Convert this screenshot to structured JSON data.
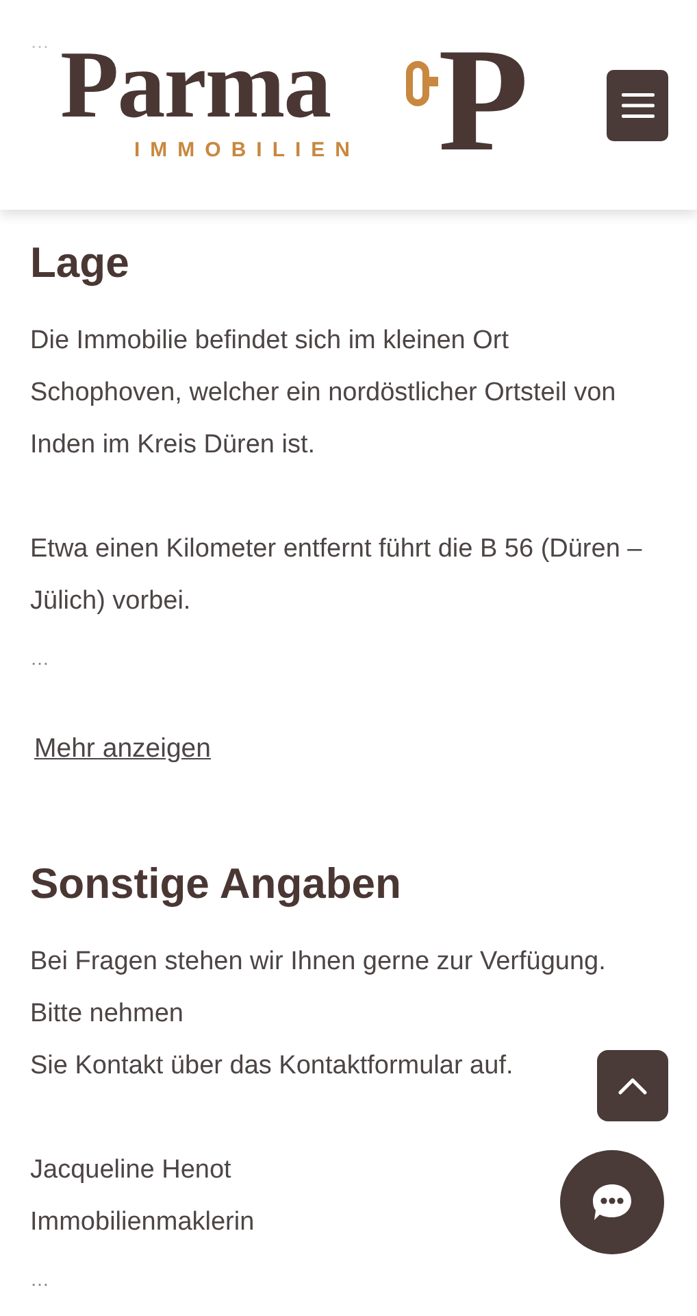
{
  "behind_header": {
    "ellipsis": "…"
  },
  "header": {
    "logo": {
      "wordmark": "Parma",
      "tagline": "IMMOBILIEN",
      "monogram": "P"
    }
  },
  "sections": [
    {
      "title": "Lage",
      "paragraphs": [
        [
          "Die Immobilie befindet sich im kleinen Ort Schophoven, welcher ein nordöstlicher Ortsteil von Inden im Kreis Düren ist."
        ],
        [
          "Etwa einen Kilometer entfernt führt die B 56 (Düren – Jülich) vorbei."
        ]
      ],
      "ellipsis": "…",
      "link": "Mehr anzeigen"
    },
    {
      "title": "Sonstige Angaben",
      "paragraphs": [
        [
          "Bei Fragen stehen wir Ihnen gerne zur Verfügung.",
          "Bitte nehmen",
          "Sie Kontakt über das Kontaktformular auf."
        ],
        [
          "Jacqueline Henot",
          "Immobilienmaklerin"
        ]
      ],
      "ellipsis": "…"
    }
  ]
}
